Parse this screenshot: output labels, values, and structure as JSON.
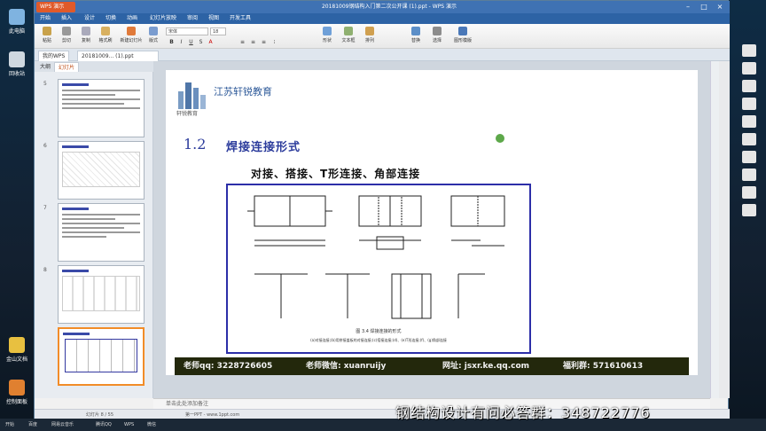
{
  "window": {
    "app_tab": "WPS 演示",
    "title": "20181009钢结构入门第二次公开课 (1).ppt - WPS 演示"
  },
  "menu": [
    "开始",
    "插入",
    "设计",
    "切换",
    "动画",
    "幻灯片放映",
    "审阅",
    "视图",
    "开发工具"
  ],
  "ribbon": {
    "buttons": [
      "粘贴",
      "剪切",
      "复制",
      "格式刷",
      "新建幻灯片",
      "版式",
      "重置",
      "节"
    ],
    "font_name": "宋体",
    "font_size": "18",
    "right_buttons": [
      "形状",
      "文本框",
      "排列",
      "替换",
      "选择",
      "图形模版"
    ]
  },
  "doc_tabs": [
    "我的WPS",
    "20181009... (1).ppt"
  ],
  "panel": {
    "tabs": [
      "大纲",
      "幻灯片"
    ],
    "slide_numbers": [
      "5",
      "6",
      "7",
      "8"
    ]
  },
  "slide": {
    "brand": "江苏轩锐教育",
    "brand_sub": "轩锐教育",
    "section_number": "1.2",
    "section_title": "焊接连接形式",
    "subtitle": "对接、搭接、T形连接、角部连接",
    "figure_caption": "图 3.4   焊接连接的形式",
    "figure_note": "(a)对接连接;(b)用拼接盖板的对接连接;(c)搭接连接;(d)、(e)T形连接;(f)、(g)角部连接",
    "banner": {
      "qq": "老师qq: 3228726605",
      "wechat": "老师微信: xuanruijy",
      "site": "网址: jsxr.ke.qq.com",
      "group": "福利群: 571610613"
    }
  },
  "notes_placeholder": "单击此处添加备注",
  "status": {
    "slide_info": "幻灯片 8 / 55",
    "theme": "第一PPT - www.1ppt.com"
  },
  "desktop_icons": [
    "此电脑",
    "回收站",
    "金山文档",
    "控制面板"
  ],
  "taskbar_items": [
    "开始",
    "百度",
    "网易云音乐",
    "腾讯QQ",
    "WPS",
    "微信"
  ],
  "caption": "钢结构设计有问必答群：348722776"
}
